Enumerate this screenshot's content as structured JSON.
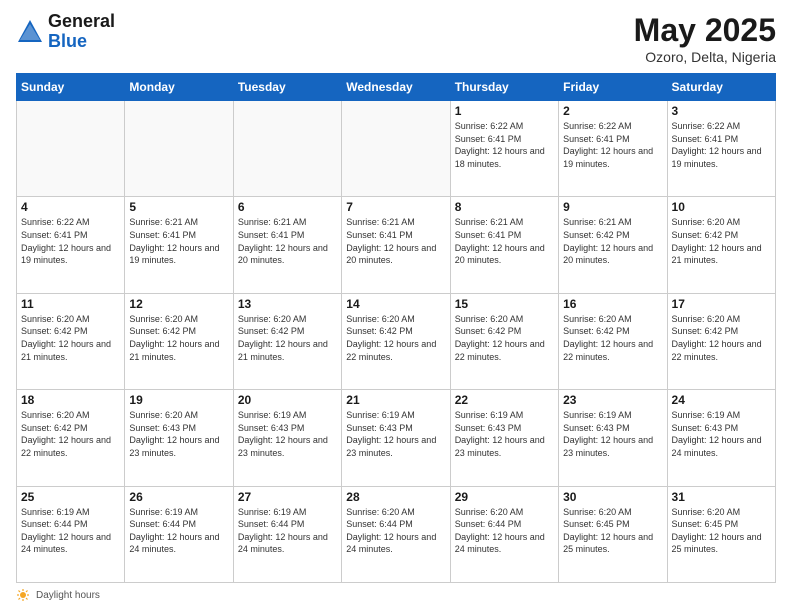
{
  "header": {
    "logo_line1": "General",
    "logo_line2": "Blue",
    "month": "May 2025",
    "location": "Ozoro, Delta, Nigeria"
  },
  "weekdays": [
    "Sunday",
    "Monday",
    "Tuesday",
    "Wednesday",
    "Thursday",
    "Friday",
    "Saturday"
  ],
  "weeks": [
    [
      {
        "day": "",
        "sunrise": "",
        "sunset": "",
        "daylight": "",
        "empty": true
      },
      {
        "day": "",
        "sunrise": "",
        "sunset": "",
        "daylight": "",
        "empty": true
      },
      {
        "day": "",
        "sunrise": "",
        "sunset": "",
        "daylight": "",
        "empty": true
      },
      {
        "day": "",
        "sunrise": "",
        "sunset": "",
        "daylight": "",
        "empty": true
      },
      {
        "day": "1",
        "sunrise": "Sunrise: 6:22 AM",
        "sunset": "Sunset: 6:41 PM",
        "daylight": "Daylight: 12 hours and 18 minutes.",
        "empty": false
      },
      {
        "day": "2",
        "sunrise": "Sunrise: 6:22 AM",
        "sunset": "Sunset: 6:41 PM",
        "daylight": "Daylight: 12 hours and 19 minutes.",
        "empty": false
      },
      {
        "day": "3",
        "sunrise": "Sunrise: 6:22 AM",
        "sunset": "Sunset: 6:41 PM",
        "daylight": "Daylight: 12 hours and 19 minutes.",
        "empty": false
      }
    ],
    [
      {
        "day": "4",
        "sunrise": "Sunrise: 6:22 AM",
        "sunset": "Sunset: 6:41 PM",
        "daylight": "Daylight: 12 hours and 19 minutes.",
        "empty": false
      },
      {
        "day": "5",
        "sunrise": "Sunrise: 6:21 AM",
        "sunset": "Sunset: 6:41 PM",
        "daylight": "Daylight: 12 hours and 19 minutes.",
        "empty": false
      },
      {
        "day": "6",
        "sunrise": "Sunrise: 6:21 AM",
        "sunset": "Sunset: 6:41 PM",
        "daylight": "Daylight: 12 hours and 20 minutes.",
        "empty": false
      },
      {
        "day": "7",
        "sunrise": "Sunrise: 6:21 AM",
        "sunset": "Sunset: 6:41 PM",
        "daylight": "Daylight: 12 hours and 20 minutes.",
        "empty": false
      },
      {
        "day": "8",
        "sunrise": "Sunrise: 6:21 AM",
        "sunset": "Sunset: 6:41 PM",
        "daylight": "Daylight: 12 hours and 20 minutes.",
        "empty": false
      },
      {
        "day": "9",
        "sunrise": "Sunrise: 6:21 AM",
        "sunset": "Sunset: 6:42 PM",
        "daylight": "Daylight: 12 hours and 20 minutes.",
        "empty": false
      },
      {
        "day": "10",
        "sunrise": "Sunrise: 6:20 AM",
        "sunset": "Sunset: 6:42 PM",
        "daylight": "Daylight: 12 hours and 21 minutes.",
        "empty": false
      }
    ],
    [
      {
        "day": "11",
        "sunrise": "Sunrise: 6:20 AM",
        "sunset": "Sunset: 6:42 PM",
        "daylight": "Daylight: 12 hours and 21 minutes.",
        "empty": false
      },
      {
        "day": "12",
        "sunrise": "Sunrise: 6:20 AM",
        "sunset": "Sunset: 6:42 PM",
        "daylight": "Daylight: 12 hours and 21 minutes.",
        "empty": false
      },
      {
        "day": "13",
        "sunrise": "Sunrise: 6:20 AM",
        "sunset": "Sunset: 6:42 PM",
        "daylight": "Daylight: 12 hours and 21 minutes.",
        "empty": false
      },
      {
        "day": "14",
        "sunrise": "Sunrise: 6:20 AM",
        "sunset": "Sunset: 6:42 PM",
        "daylight": "Daylight: 12 hours and 22 minutes.",
        "empty": false
      },
      {
        "day": "15",
        "sunrise": "Sunrise: 6:20 AM",
        "sunset": "Sunset: 6:42 PM",
        "daylight": "Daylight: 12 hours and 22 minutes.",
        "empty": false
      },
      {
        "day": "16",
        "sunrise": "Sunrise: 6:20 AM",
        "sunset": "Sunset: 6:42 PM",
        "daylight": "Daylight: 12 hours and 22 minutes.",
        "empty": false
      },
      {
        "day": "17",
        "sunrise": "Sunrise: 6:20 AM",
        "sunset": "Sunset: 6:42 PM",
        "daylight": "Daylight: 12 hours and 22 minutes.",
        "empty": false
      }
    ],
    [
      {
        "day": "18",
        "sunrise": "Sunrise: 6:20 AM",
        "sunset": "Sunset: 6:42 PM",
        "daylight": "Daylight: 12 hours and 22 minutes.",
        "empty": false
      },
      {
        "day": "19",
        "sunrise": "Sunrise: 6:20 AM",
        "sunset": "Sunset: 6:43 PM",
        "daylight": "Daylight: 12 hours and 23 minutes.",
        "empty": false
      },
      {
        "day": "20",
        "sunrise": "Sunrise: 6:19 AM",
        "sunset": "Sunset: 6:43 PM",
        "daylight": "Daylight: 12 hours and 23 minutes.",
        "empty": false
      },
      {
        "day": "21",
        "sunrise": "Sunrise: 6:19 AM",
        "sunset": "Sunset: 6:43 PM",
        "daylight": "Daylight: 12 hours and 23 minutes.",
        "empty": false
      },
      {
        "day": "22",
        "sunrise": "Sunrise: 6:19 AM",
        "sunset": "Sunset: 6:43 PM",
        "daylight": "Daylight: 12 hours and 23 minutes.",
        "empty": false
      },
      {
        "day": "23",
        "sunrise": "Sunrise: 6:19 AM",
        "sunset": "Sunset: 6:43 PM",
        "daylight": "Daylight: 12 hours and 23 minutes.",
        "empty": false
      },
      {
        "day": "24",
        "sunrise": "Sunrise: 6:19 AM",
        "sunset": "Sunset: 6:43 PM",
        "daylight": "Daylight: 12 hours and 24 minutes.",
        "empty": false
      }
    ],
    [
      {
        "day": "25",
        "sunrise": "Sunrise: 6:19 AM",
        "sunset": "Sunset: 6:44 PM",
        "daylight": "Daylight: 12 hours and 24 minutes.",
        "empty": false
      },
      {
        "day": "26",
        "sunrise": "Sunrise: 6:19 AM",
        "sunset": "Sunset: 6:44 PM",
        "daylight": "Daylight: 12 hours and 24 minutes.",
        "empty": false
      },
      {
        "day": "27",
        "sunrise": "Sunrise: 6:19 AM",
        "sunset": "Sunset: 6:44 PM",
        "daylight": "Daylight: 12 hours and 24 minutes.",
        "empty": false
      },
      {
        "day": "28",
        "sunrise": "Sunrise: 6:20 AM",
        "sunset": "Sunset: 6:44 PM",
        "daylight": "Daylight: 12 hours and 24 minutes.",
        "empty": false
      },
      {
        "day": "29",
        "sunrise": "Sunrise: 6:20 AM",
        "sunset": "Sunset: 6:44 PM",
        "daylight": "Daylight: 12 hours and 24 minutes.",
        "empty": false
      },
      {
        "day": "30",
        "sunrise": "Sunrise: 6:20 AM",
        "sunset": "Sunset: 6:45 PM",
        "daylight": "Daylight: 12 hours and 25 minutes.",
        "empty": false
      },
      {
        "day": "31",
        "sunrise": "Sunrise: 6:20 AM",
        "sunset": "Sunset: 6:45 PM",
        "daylight": "Daylight: 12 hours and 25 minutes.",
        "empty": false
      }
    ]
  ],
  "footer": {
    "label": "Daylight hours"
  }
}
